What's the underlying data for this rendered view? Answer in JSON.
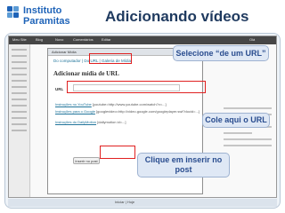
{
  "slide": {
    "logo_line1": "Instituto",
    "logo_line2": "Paramitas",
    "title": "Adicionando vídeos",
    "brand_color": "#1e63b8"
  },
  "screenshot": {
    "admin_bar": [
      "Meu Site",
      "Blog",
      "Novo",
      "Comentários",
      "Editar",
      "Olá"
    ],
    "modal": {
      "titlebar": "Adicionar Mídia",
      "tabs": "Do computador  |  Do URL  |  Galeria de Mídia",
      "heading": "Adicionar mídia de URL",
      "url_label": "URL",
      "instructions": [
        {
          "prefix": "Instruções no YouTube",
          "text": "[youtube=http://www.youtube.com/watch?v=...]"
        },
        {
          "prefix": "Instruções para o Google",
          "text": "[googlevideo=http://video.google.com/googleplayer.swf?docid=...]"
        },
        {
          "prefix": "Instruções do DailyMotion",
          "text": "[dailymotion id=...]"
        }
      ],
      "insert_button": "Inserir no post"
    },
    "status_text": "Iniciar | Hoje"
  },
  "callouts": {
    "select_url": "Selecione “de um URL”",
    "paste_here": "Cole aqui o URL",
    "click_insert": "Clique em inserir no post"
  }
}
